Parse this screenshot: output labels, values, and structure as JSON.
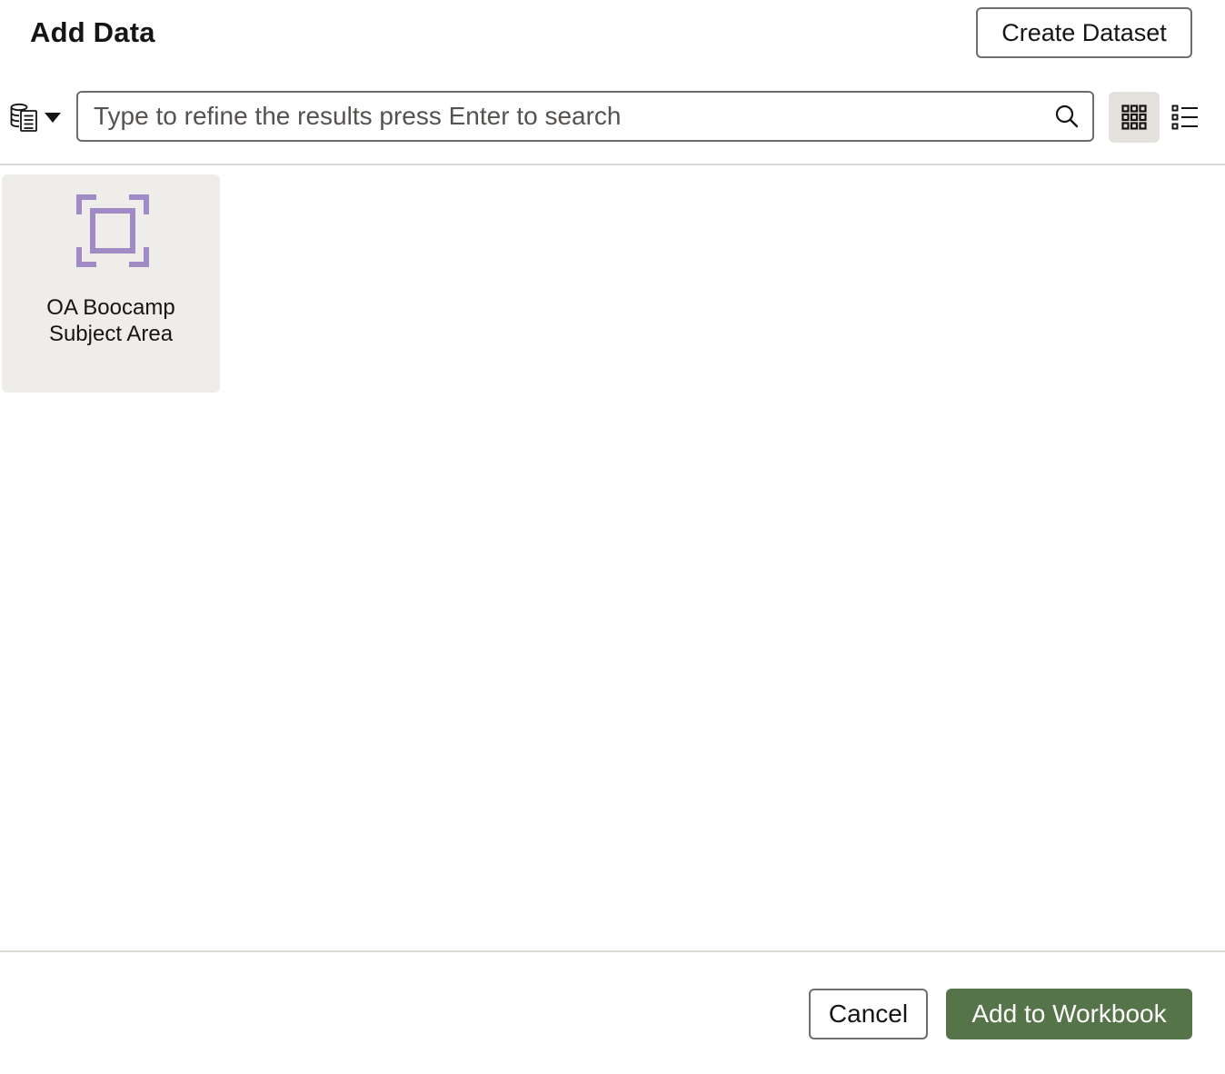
{
  "dialog": {
    "title": "Add Data",
    "create_dataset_label": "Create Dataset"
  },
  "toolbar": {
    "source_picker_icon": "database-catalog-icon",
    "search": {
      "placeholder": "Type to refine the results press Enter to search",
      "value": ""
    },
    "view_modes": [
      {
        "name": "grid-view",
        "icon": "grid-icon",
        "selected": true
      },
      {
        "name": "list-view",
        "icon": "list-icon",
        "selected": false
      }
    ]
  },
  "results": {
    "items": [
      {
        "label": "OA Boocamp Subject Area",
        "icon": "subject-area-icon",
        "icon_color": "#a08bc4"
      }
    ]
  },
  "footer": {
    "cancel_label": "Cancel",
    "add_label": "Add to Workbook"
  },
  "colors": {
    "primary_button": "#56744a",
    "selected_view_bg": "#e4e1dd",
    "tile_bg": "#efedea"
  }
}
